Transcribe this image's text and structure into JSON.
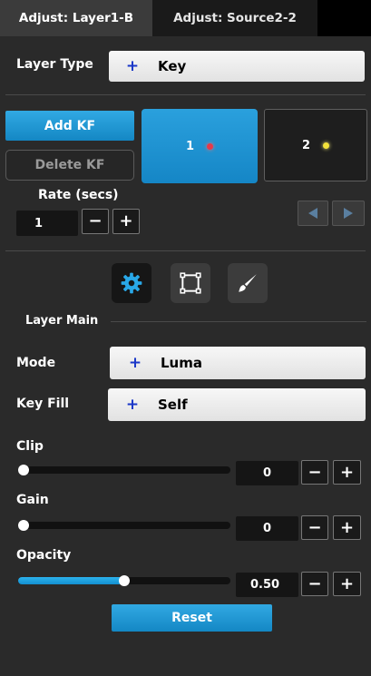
{
  "tabs": [
    {
      "label": "Adjust: Layer1-B",
      "active": true
    },
    {
      "label": "Adjust: Source2-2",
      "active": false
    }
  ],
  "layer_type": {
    "label": "Layer Type",
    "prefix": "+",
    "value": "Key"
  },
  "keyframes": {
    "add_label": "Add KF",
    "delete_label": "Delete KF",
    "items": [
      {
        "label": "1",
        "dot_color": "#e5394a",
        "selected": true
      },
      {
        "label": "2",
        "dot_color": "#f3e23a",
        "selected": false
      }
    ],
    "rate_label": "Rate (secs)",
    "rate_value": "1",
    "minus": "−",
    "plus": "+"
  },
  "tools": [
    {
      "icon": "gear-icon",
      "active": true
    },
    {
      "icon": "crop-frame-icon",
      "active": false
    },
    {
      "icon": "brush-icon",
      "active": false
    }
  ],
  "section": {
    "title": "Layer Main"
  },
  "mode": {
    "label": "Mode",
    "prefix": "+",
    "value": "Luma"
  },
  "key_fill": {
    "label": "Key Fill",
    "prefix": "+",
    "value": "Self"
  },
  "sliders": [
    {
      "label": "Clip",
      "value": "0",
      "level": 0.0
    },
    {
      "label": "Gain",
      "value": "0",
      "level": 0.0
    },
    {
      "label": "Opacity",
      "value": "0.50",
      "level": 0.5
    }
  ],
  "reset_label": "Reset",
  "colors": {
    "accent": "#1a8fd0",
    "background": "#2a2a2a"
  }
}
